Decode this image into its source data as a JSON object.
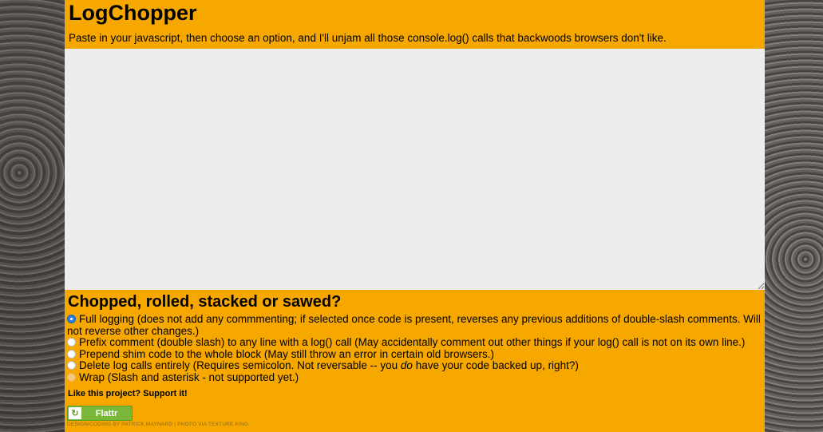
{
  "page": {
    "title": "LogChopper",
    "intro": "Paste in your javascript, then choose an option, and I'll unjam all those console.log() calls that backwoods browsers don't like."
  },
  "editor": {
    "value": ""
  },
  "options_section": {
    "heading": "Chopped, rolled, stacked or sawed?",
    "options": [
      {
        "label": "Full logging (does not add any commmenting; if selected once code is present, reverses any previous additions of double-slash comments. Will not reverse other changes.)",
        "checked": true,
        "disabled": false
      },
      {
        "label": "Prefix comment (double slash) to any line with a log() call (May accidentally comment out other things if your log() call is not on its own line.)",
        "checked": false,
        "disabled": false
      },
      {
        "label": "Prepend shim code to the whole block (May still throw an error in certain old browsers.)",
        "checked": false,
        "disabled": false
      },
      {
        "label_before": "Delete log calls entirely (Requires semicolon. Not reversable -- you ",
        "label_em": "do",
        "label_after": " have your code backed up, right?)",
        "checked": false,
        "disabled": false
      },
      {
        "label": "Wrap (Slash and asterisk - not supported yet.)",
        "checked": false,
        "disabled": true
      }
    ]
  },
  "support": {
    "text": "Like this project? Support it!",
    "flattr_label": "Flattr"
  },
  "credits": {
    "text": "DESIGN/CODING BY PATRICK MAYNARD | PHOTO VIA TEXTURE KING"
  },
  "colors": {
    "panel": "#f6a800",
    "editor_bg": "#ededed",
    "radio_selected": "#2b80e6",
    "flattr_green": "#7ab83a"
  }
}
